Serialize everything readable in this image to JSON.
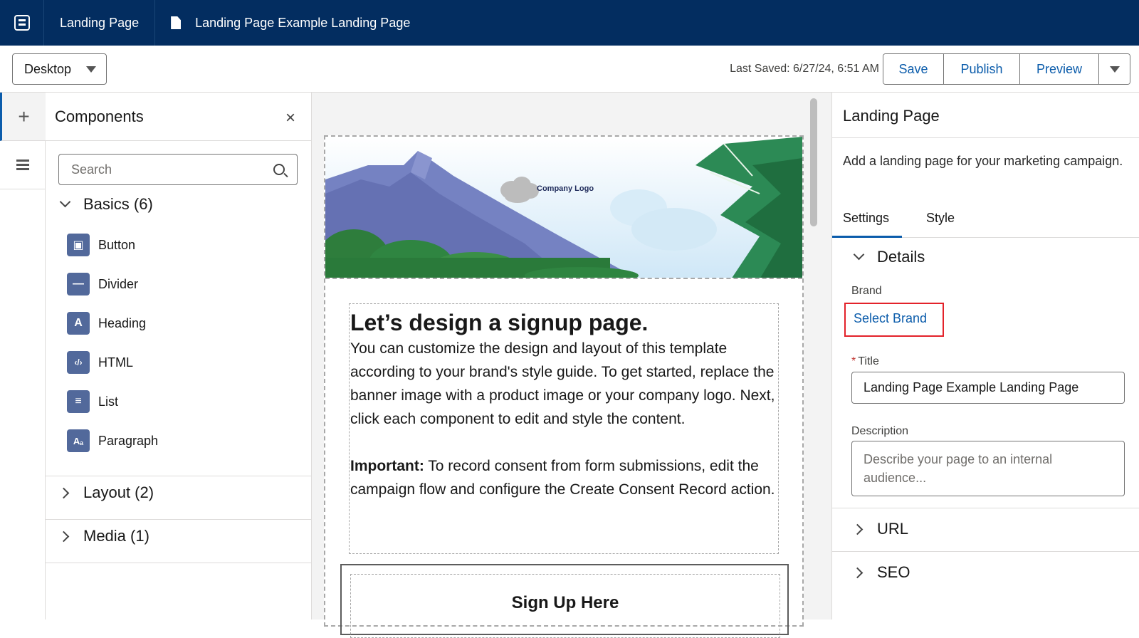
{
  "topbar": {
    "app_icon": "builder-app-icon",
    "tab1": "Landing Page",
    "tab2": "Landing Page Example Landing Page"
  },
  "toolbar": {
    "device": "Desktop",
    "last_saved": "Last Saved: 6/27/24, 6:51 AM",
    "save": "Save",
    "publish": "Publish",
    "preview": "Preview"
  },
  "components": {
    "title": "Components",
    "search_placeholder": "Search",
    "basics": "Basics (6)",
    "items": [
      "Button",
      "Divider",
      "Heading",
      "HTML",
      "List",
      "Paragraph"
    ],
    "layout": "Layout (2)",
    "media": "Media (1)"
  },
  "canvas": {
    "logo_text": "Company Logo",
    "heading": "Let’s design a signup page.",
    "paragraph": "You can customize the design and layout of this template according to your brand's style guide. To get started, replace the banner image with a product image or your company logo. Next, click each component to edit and style the content.",
    "important_label": "Important:",
    "important_text": " To record consent from form submissions, edit the campaign flow and configure the Create Consent Record action.",
    "form_title": "Sign Up Here"
  },
  "props": {
    "title": "Landing Page",
    "description": "Add a landing page for your marketing campaign.",
    "tabs": [
      "Settings",
      "Style"
    ],
    "details": "Details",
    "brand_label": "Brand",
    "brand_link": "Select Brand",
    "title_label": "Title",
    "title_value": "Landing Page Example Landing Page",
    "desc_label": "Description",
    "desc_placeholder": "Describe your page to an internal audience...",
    "url": "URL",
    "seo": "SEO"
  },
  "colors": {
    "nav_bg": "#032d60",
    "link": "#0b5cab",
    "highlight": "#e3222a"
  }
}
